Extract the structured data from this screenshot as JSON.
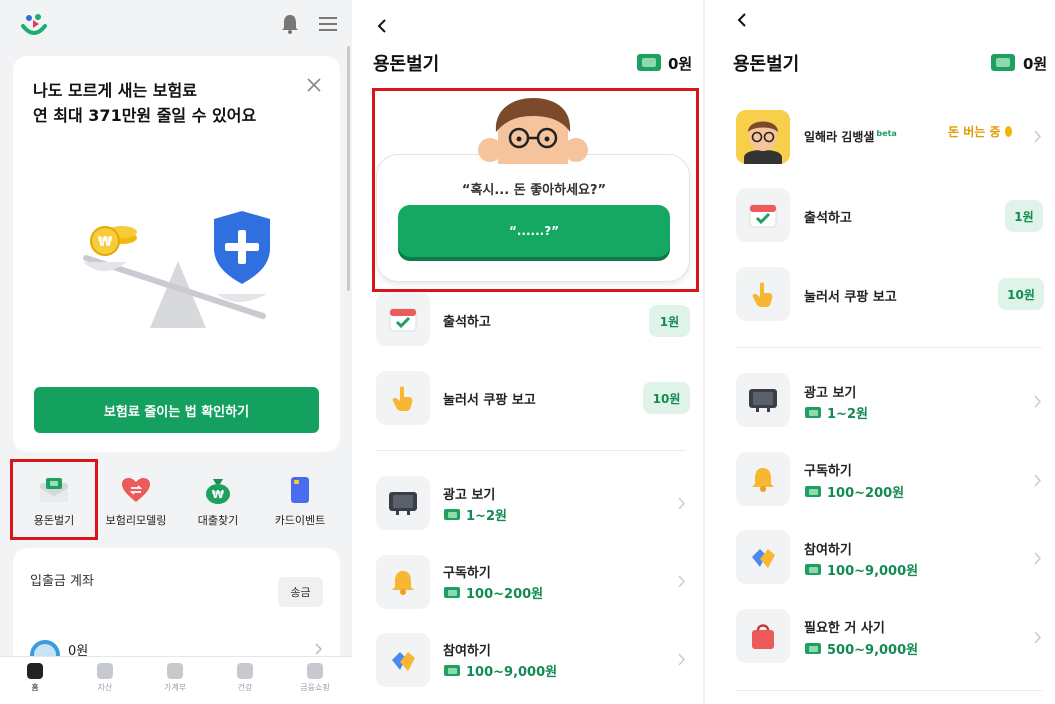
{
  "left": {
    "insurance_card": {
      "title": "나도 모르게 새는 보험료\n연 최대 371만원 줄일 수 있어요",
      "cta": "보험료 줄이는 법 확인하기"
    },
    "quick_menu": [
      {
        "label": "용돈벌기",
        "icon": "money-envelope-icon"
      },
      {
        "label": "보험리모델링",
        "icon": "heart-refresh-icon"
      },
      {
        "label": "대출찾기",
        "icon": "money-bag-icon"
      },
      {
        "label": "카드이벤트",
        "icon": "card-icon"
      }
    ],
    "account": {
      "title": "입출금 계좌",
      "send_label": "송금",
      "balance": "0원"
    },
    "tabs": [
      {
        "label": "홈"
      },
      {
        "label": "자산"
      },
      {
        "label": "가계부"
      },
      {
        "label": "건강"
      },
      {
        "label": "금융쇼핑"
      }
    ]
  },
  "middle": {
    "title": "용돈벌기",
    "balance": "0원",
    "prompt": "“혹시... 돈 좋아하세요?”",
    "answer_button": "“......?”",
    "rewards": [
      {
        "label": "출석하고",
        "amount": "1원",
        "icon": "calendar-check-icon"
      },
      {
        "label": "눌러서 쿠팡 보고",
        "amount": "10원",
        "icon": "tap-hand-icon"
      }
    ],
    "tasks": [
      {
        "label": "광고 보기",
        "range": "1~2원",
        "icon": "tv-icon"
      },
      {
        "label": "구독하기",
        "range": "100~200원",
        "icon": "bell-icon"
      },
      {
        "label": "참여하기",
        "range": "100~9,000원",
        "icon": "clap-icon"
      }
    ]
  },
  "right": {
    "title": "용돈벌기",
    "balance": "0원",
    "kim": {
      "label": "일해라 김뱅샐",
      "beta": "beta",
      "status": "돈 버는 중"
    },
    "rewards": [
      {
        "label": "출석하고",
        "amount": "1원",
        "icon": "calendar-check-icon"
      },
      {
        "label": "눌러서 쿠팡 보고",
        "amount": "10원",
        "icon": "tap-hand-icon"
      }
    ],
    "tasks": [
      {
        "label": "광고 보기",
        "range": "1~2원",
        "icon": "tv-icon"
      },
      {
        "label": "구독하기",
        "range": "100~200원",
        "icon": "bell-icon"
      },
      {
        "label": "참여하기",
        "range": "100~9,000원",
        "icon": "clap-icon"
      },
      {
        "label": "필요한 거 사기",
        "range": "500~9,000원",
        "icon": "shopping-bag-icon"
      }
    ]
  },
  "colors": {
    "brand_green": "#14a05f",
    "highlight_red": "#d9141b",
    "earning_orange": "#e29a00"
  }
}
